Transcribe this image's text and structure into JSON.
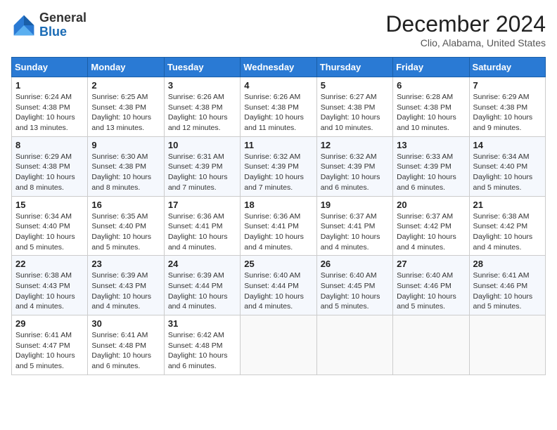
{
  "header": {
    "logo_general": "General",
    "logo_blue": "Blue",
    "title": "December 2024",
    "location": "Clio, Alabama, United States"
  },
  "weekdays": [
    "Sunday",
    "Monday",
    "Tuesday",
    "Wednesday",
    "Thursday",
    "Friday",
    "Saturday"
  ],
  "weeks": [
    [
      {
        "day": "1",
        "sunrise": "6:24 AM",
        "sunset": "4:38 PM",
        "daylight": "10 hours and 13 minutes."
      },
      {
        "day": "2",
        "sunrise": "6:25 AM",
        "sunset": "4:38 PM",
        "daylight": "10 hours and 13 minutes."
      },
      {
        "day": "3",
        "sunrise": "6:26 AM",
        "sunset": "4:38 PM",
        "daylight": "10 hours and 12 minutes."
      },
      {
        "day": "4",
        "sunrise": "6:26 AM",
        "sunset": "4:38 PM",
        "daylight": "10 hours and 11 minutes."
      },
      {
        "day": "5",
        "sunrise": "6:27 AM",
        "sunset": "4:38 PM",
        "daylight": "10 hours and 10 minutes."
      },
      {
        "day": "6",
        "sunrise": "6:28 AM",
        "sunset": "4:38 PM",
        "daylight": "10 hours and 10 minutes."
      },
      {
        "day": "7",
        "sunrise": "6:29 AM",
        "sunset": "4:38 PM",
        "daylight": "10 hours and 9 minutes."
      }
    ],
    [
      {
        "day": "8",
        "sunrise": "6:29 AM",
        "sunset": "4:38 PM",
        "daylight": "10 hours and 8 minutes."
      },
      {
        "day": "9",
        "sunrise": "6:30 AM",
        "sunset": "4:38 PM",
        "daylight": "10 hours and 8 minutes."
      },
      {
        "day": "10",
        "sunrise": "6:31 AM",
        "sunset": "4:39 PM",
        "daylight": "10 hours and 7 minutes."
      },
      {
        "day": "11",
        "sunrise": "6:32 AM",
        "sunset": "4:39 PM",
        "daylight": "10 hours and 7 minutes."
      },
      {
        "day": "12",
        "sunrise": "6:32 AM",
        "sunset": "4:39 PM",
        "daylight": "10 hours and 6 minutes."
      },
      {
        "day": "13",
        "sunrise": "6:33 AM",
        "sunset": "4:39 PM",
        "daylight": "10 hours and 6 minutes."
      },
      {
        "day": "14",
        "sunrise": "6:34 AM",
        "sunset": "4:40 PM",
        "daylight": "10 hours and 5 minutes."
      }
    ],
    [
      {
        "day": "15",
        "sunrise": "6:34 AM",
        "sunset": "4:40 PM",
        "daylight": "10 hours and 5 minutes."
      },
      {
        "day": "16",
        "sunrise": "6:35 AM",
        "sunset": "4:40 PM",
        "daylight": "10 hours and 5 minutes."
      },
      {
        "day": "17",
        "sunrise": "6:36 AM",
        "sunset": "4:41 PM",
        "daylight": "10 hours and 4 minutes."
      },
      {
        "day": "18",
        "sunrise": "6:36 AM",
        "sunset": "4:41 PM",
        "daylight": "10 hours and 4 minutes."
      },
      {
        "day": "19",
        "sunrise": "6:37 AM",
        "sunset": "4:41 PM",
        "daylight": "10 hours and 4 minutes."
      },
      {
        "day": "20",
        "sunrise": "6:37 AM",
        "sunset": "4:42 PM",
        "daylight": "10 hours and 4 minutes."
      },
      {
        "day": "21",
        "sunrise": "6:38 AM",
        "sunset": "4:42 PM",
        "daylight": "10 hours and 4 minutes."
      }
    ],
    [
      {
        "day": "22",
        "sunrise": "6:38 AM",
        "sunset": "4:43 PM",
        "daylight": "10 hours and 4 minutes."
      },
      {
        "day": "23",
        "sunrise": "6:39 AM",
        "sunset": "4:43 PM",
        "daylight": "10 hours and 4 minutes."
      },
      {
        "day": "24",
        "sunrise": "6:39 AM",
        "sunset": "4:44 PM",
        "daylight": "10 hours and 4 minutes."
      },
      {
        "day": "25",
        "sunrise": "6:40 AM",
        "sunset": "4:44 PM",
        "daylight": "10 hours and 4 minutes."
      },
      {
        "day": "26",
        "sunrise": "6:40 AM",
        "sunset": "4:45 PM",
        "daylight": "10 hours and 5 minutes."
      },
      {
        "day": "27",
        "sunrise": "6:40 AM",
        "sunset": "4:46 PM",
        "daylight": "10 hours and 5 minutes."
      },
      {
        "day": "28",
        "sunrise": "6:41 AM",
        "sunset": "4:46 PM",
        "daylight": "10 hours and 5 minutes."
      }
    ],
    [
      {
        "day": "29",
        "sunrise": "6:41 AM",
        "sunset": "4:47 PM",
        "daylight": "10 hours and 5 minutes."
      },
      {
        "day": "30",
        "sunrise": "6:41 AM",
        "sunset": "4:48 PM",
        "daylight": "10 hours and 6 minutes."
      },
      {
        "day": "31",
        "sunrise": "6:42 AM",
        "sunset": "4:48 PM",
        "daylight": "10 hours and 6 minutes."
      },
      null,
      null,
      null,
      null
    ]
  ]
}
